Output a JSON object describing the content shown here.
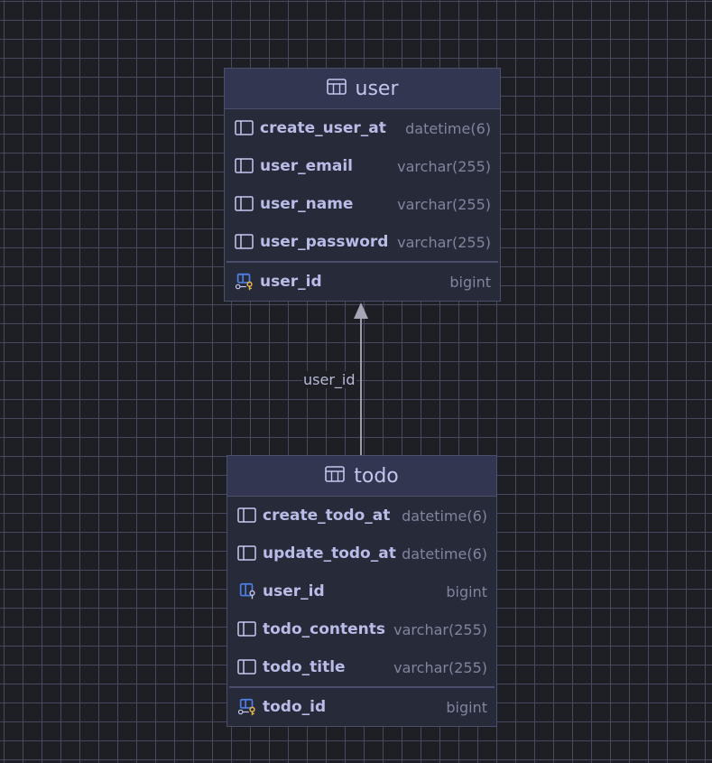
{
  "tables": {
    "user": {
      "title": "user",
      "columns": [
        {
          "name": "create_user_at",
          "type": "datetime(6)"
        },
        {
          "name": "user_email",
          "type": "varchar(255)"
        },
        {
          "name": "user_name",
          "type": "varchar(255)"
        },
        {
          "name": "user_password",
          "type": "varchar(255)"
        }
      ],
      "primary_key": {
        "name": "user_id",
        "type": "bigint"
      }
    },
    "todo": {
      "title": "todo",
      "columns": [
        {
          "name": "create_todo_at",
          "type": "datetime(6)"
        },
        {
          "name": "update_todo_at",
          "type": "datetime(6)"
        },
        {
          "name": "user_id",
          "type": "bigint"
        },
        {
          "name": "todo_contents",
          "type": "varchar(255)"
        },
        {
          "name": "todo_title",
          "type": "varchar(255)"
        }
      ],
      "primary_key": {
        "name": "todo_id",
        "type": "bigint"
      }
    }
  },
  "relation": {
    "label": "user_id"
  },
  "colors": {
    "background": "#1e1f25",
    "grid": "#4a4860",
    "table_body": "#272a39",
    "table_header": "#323650",
    "key_icon": "#e5b94a",
    "fk_icon": "#4f7fe6"
  }
}
